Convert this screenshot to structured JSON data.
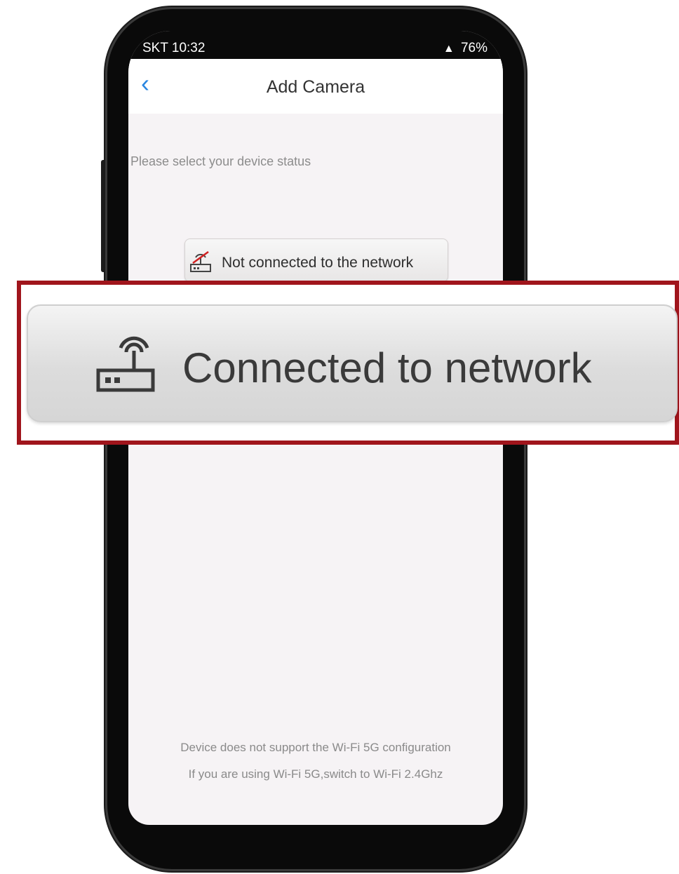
{
  "status_bar": {
    "carrier_time": "SKT 10:32",
    "notif_icons": "⬇ 💬 ©  •",
    "battery_text": "76%"
  },
  "nav": {
    "back_icon": "chevron-left",
    "title": "Add Camera"
  },
  "prompt": "Please select your device status",
  "options": {
    "not_connected": {
      "label": "Not connected to the network",
      "icon": "router-off-icon"
    },
    "connected": {
      "label": "Connected to network",
      "icon": "router-wifi-icon"
    }
  },
  "note": {
    "line1": "Device does not support the Wi-Fi 5G configuration",
    "line2": "If you are using Wi-Fi 5G,switch to Wi-Fi 2.4Ghz"
  },
  "colors": {
    "accent": "#2a86e0",
    "highlight_border": "#a0151c"
  }
}
